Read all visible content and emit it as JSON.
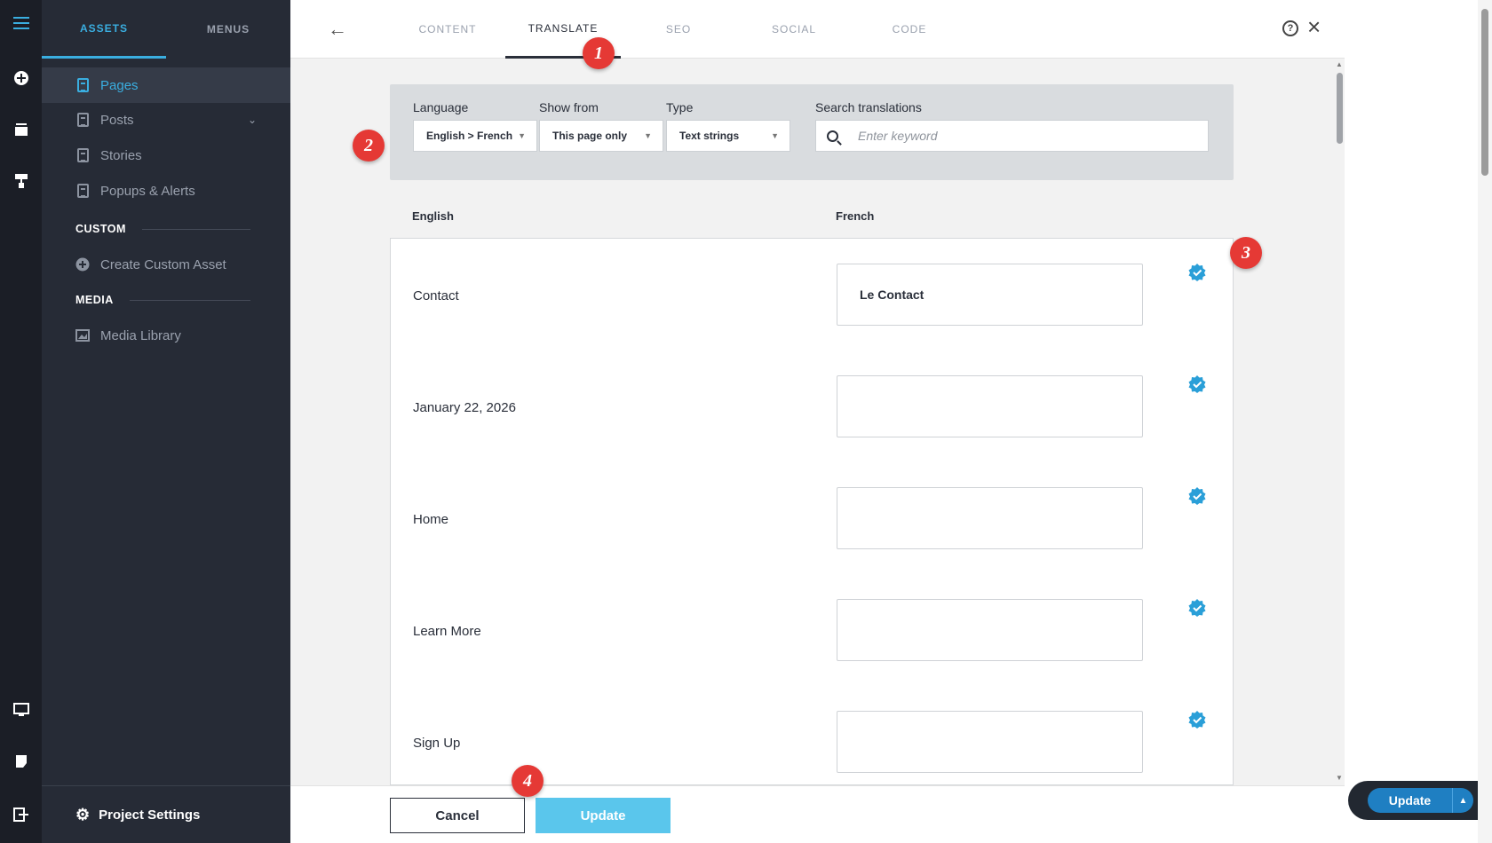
{
  "sidebar": {
    "tabs": [
      "ASSETS",
      "MENUS"
    ],
    "items": [
      {
        "label": "Pages",
        "icon": "page-icon"
      },
      {
        "label": "Posts",
        "icon": "page-icon"
      },
      {
        "label": "Stories",
        "icon": "page-icon"
      },
      {
        "label": "Popups & Alerts",
        "icon": "page-icon"
      }
    ],
    "custom_heading": "CUSTOM",
    "create_custom": "Create Custom Asset",
    "media_heading": "MEDIA",
    "media_library": "Media Library",
    "project_settings": "Project Settings"
  },
  "topbar": {
    "tabs": [
      "CONTENT",
      "TRANSLATE",
      "SEO",
      "SOCIAL",
      "CODE"
    ],
    "active_tab": "TRANSLATE",
    "help": "?"
  },
  "filters": {
    "language_label": "Language",
    "language_value": "English > French",
    "show_from_label": "Show from",
    "show_from_value": "This page only",
    "type_label": "Type",
    "type_value": "Text strings",
    "search_label": "Search translations",
    "search_placeholder": "Enter keyword"
  },
  "columns": {
    "source": "English",
    "target": "French"
  },
  "rows": [
    {
      "source": "Contact",
      "target": "Le Contact"
    },
    {
      "source": "January 22, 2026",
      "target": ""
    },
    {
      "source": "Home",
      "target": ""
    },
    {
      "source": "Learn More",
      "target": ""
    },
    {
      "source": "Sign Up",
      "target": ""
    }
  ],
  "buttons": {
    "cancel": "Cancel",
    "update": "Update"
  },
  "float_update": "Update",
  "markers": [
    "1",
    "2",
    "3",
    "4"
  ],
  "colors": {
    "accent": "#3aaee0",
    "marker": "#e53935",
    "update_button": "#5ac6ec",
    "check": "#2a9fd8"
  }
}
